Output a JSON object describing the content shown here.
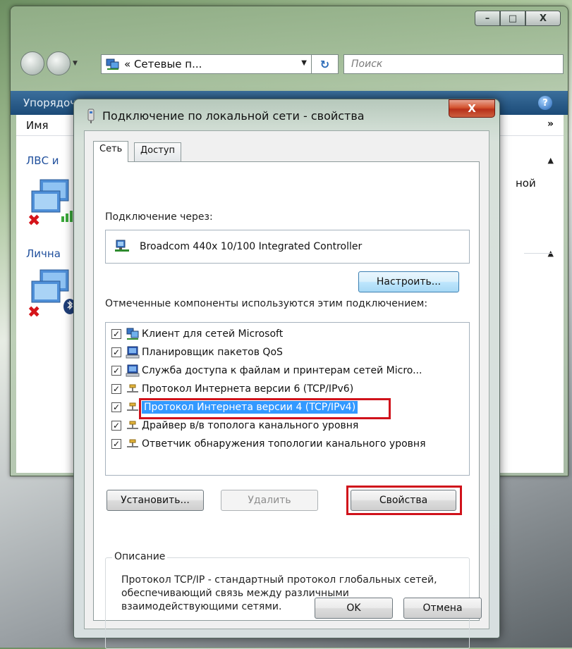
{
  "explorer": {
    "window_buttons": [
      "–",
      "□",
      "X"
    ],
    "address": "« Сетевые п...",
    "search_placeholder": "Поиск",
    "toolbar_text": "Упорядочить",
    "help_label": "?",
    "column_header": "Имя",
    "column_more": "»",
    "group1": "ЛВС и",
    "group2": "Лична",
    "side_text": "ной"
  },
  "dialog": {
    "title": "Подключение по локальной сети - свойства",
    "close_label": "X",
    "tabs": [
      {
        "label": "Сеть"
      },
      {
        "label": "Доступ"
      }
    ],
    "connect_via_label": "Подключение через:",
    "adapter_name": "Broadcom 440x 10/100 Integrated Controller",
    "configure_button": "Настроить...",
    "components_label": "Отмеченные компоненты используются этим подключением:",
    "components": [
      {
        "label": "Клиент для сетей Microsoft",
        "checked": true,
        "icon": "client-icon"
      },
      {
        "label": "Планировщик пакетов QoS",
        "checked": true,
        "icon": "service-icon"
      },
      {
        "label": "Служба доступа к файлам и принтерам сетей Micro...",
        "checked": true,
        "icon": "service-icon"
      },
      {
        "label": "Протокол Интернета версии 6 (TCP/IPv6)",
        "checked": true,
        "icon": "protocol-icon"
      },
      {
        "label": "Протокол Интернета версии 4 (TCP/IPv4)",
        "checked": true,
        "icon": "protocol-icon",
        "selected": true
      },
      {
        "label": "Драйвер в/в тополога канального уровня",
        "checked": true,
        "icon": "protocol-icon"
      },
      {
        "label": "Ответчик обнаружения топологии канального уровня",
        "checked": true,
        "icon": "protocol-icon"
      }
    ],
    "check_mark": "✓",
    "install_button": "Установить...",
    "uninstall_button": "Удалить",
    "properties_button": "Свойства",
    "description_legend": "Описание",
    "description_text": "Протокол TCP/IP - стандартный протокол глобальных сетей, обеспечивающий связь между различными взаимодействующими сетями.",
    "ok_button": "OK",
    "cancel_button": "Отмена"
  },
  "colors": {
    "highlight_box": "#d0121b",
    "selection": "#3399ff",
    "close_button": "#c9452a"
  }
}
